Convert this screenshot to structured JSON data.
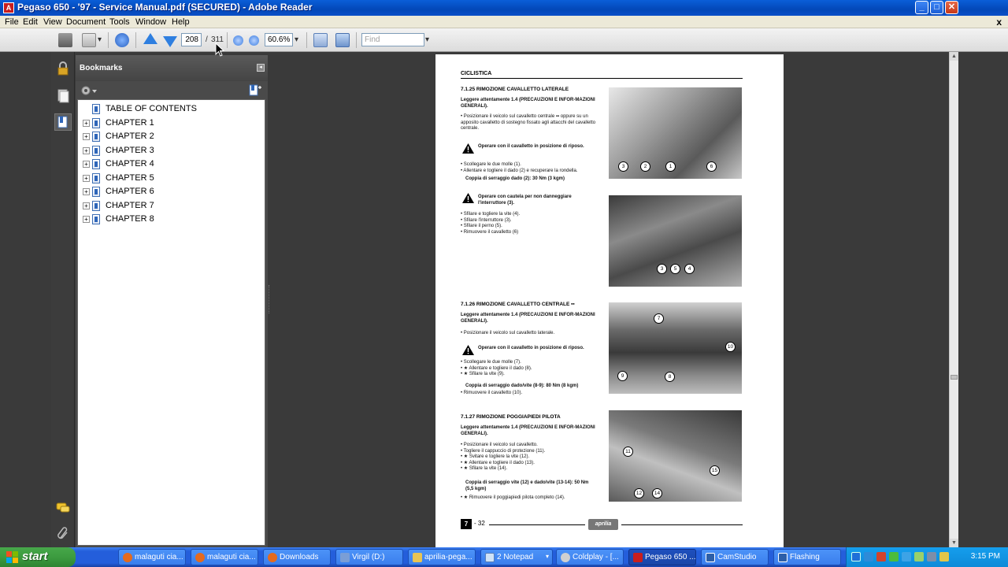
{
  "window": {
    "title": "Pegaso 650 - '97 - Service Manual.pdf (SECURED) - Adobe Reader",
    "app_icon_glyph": "A",
    "minimize": "_",
    "maximize": "□",
    "close": "✕"
  },
  "menu": {
    "items": [
      "File",
      "Edit",
      "View",
      "Document",
      "Tools",
      "Window",
      "Help"
    ],
    "doc_close": "x"
  },
  "toolbar": {
    "page_current": "208",
    "page_separator": "/",
    "page_total": "311",
    "zoom": "60.6%",
    "find_placeholder": "Find"
  },
  "bookmarks": {
    "title": "Bookmarks",
    "items": [
      {
        "label": "TABLE OF CONTENTS",
        "expandable": false
      },
      {
        "label": "CHAPTER 1",
        "expandable": true
      },
      {
        "label": "CHAPTER 2",
        "expandable": true
      },
      {
        "label": "CHAPTER 3",
        "expandable": true
      },
      {
        "label": "CHAPTER 4",
        "expandable": true
      },
      {
        "label": "CHAPTER 5",
        "expandable": true
      },
      {
        "label": "CHAPTER 6",
        "expandable": true
      },
      {
        "label": "CHAPTER 7",
        "expandable": true
      },
      {
        "label": "CHAPTER 8",
        "expandable": true
      }
    ]
  },
  "page": {
    "header": "CICLISTICA",
    "sections": [
      {
        "title": "7.1.25  RIMOZIONE CAVALLETTO LATERALE",
        "intro": "Leggere attentamente 1.4 (PRECAUZIONI E INFOR-MAZIONI GENERALI).",
        "bullet1": "• Posizionare il veicolo sul cavalletto centrale ▪▪ oppure su un apposito cavalletto di sostegno fissato agli attacchi del cavalletto centrale.",
        "warning1": "Operare con il cavalletto in posizione di riposo.",
        "steps1": "• Scollegare le due molle (1).\n• Allentare e togliere il dado (2) e recuperare la rondella.",
        "torque1": "Coppia di serraggio dado (2): 30 Nm (3 kgm)",
        "warning2": "Operare con cautela per non danneggiare l'interruttore (3).",
        "steps2": "• Sfilare e togliere la vite (4).\n• Sfilare l'interruttore (3).\n• Sfilare il perno (5).\n• Rimuovere il cavalletto (6)",
        "photo1_callouts": [
          "3",
          "2",
          "1",
          "6"
        ],
        "photo2_callouts": [
          "3",
          "5",
          "4"
        ]
      },
      {
        "title": "7.1.26  RIMOZIONE CAVALLETTO CENTRALE ▪▪",
        "intro": "Leggere attentamente 1.4 (PRECAUZIONI E INFOR-MAZIONI GENERALI).",
        "bullet1": "• Posizionare il veicolo sul cavalletto laterale.",
        "warning1": "Operare con il cavalletto in posizione di riposo.",
        "steps1": "• Scollegare le due molle (7).\n• ★ Allentare e togliere il dado (8).\n• ★ Sfilare la vite (9).",
        "torque1": "Coppia di serraggio dado/vite (8-9): 80 Nm (8 kgm)",
        "steps2": "• Rimuovere il cavalletto (10).",
        "photo_callouts": [
          "7",
          "10",
          "9",
          "8"
        ]
      },
      {
        "title": "7.1.27  RIMOZIONE POGGIAPIEDI PILOTA",
        "intro": "Leggere attentamente 1.4 (PRECAUZIONI E INFOR-MAZIONI GENERALI).",
        "steps1": "• Posizionare il veicolo sul cavalletto.\n• Togliere il cappuccio di protezione (11).\n• ★ Svitare e togliere la vite (12).\n• ★ Allentare e togliere il dado (13).\n• ★ Sfilare la vite (14).",
        "torque1": "Coppia di serraggio vite (12) e dado/vite (13-14): 50 Nm (5,5 kgm)",
        "steps2": "• ★ Rimuovere il poggiapiedi pilota completo (14).",
        "photo_callouts": [
          "11",
          "15",
          "12",
          "14"
        ]
      }
    ],
    "footer_chapter": "7",
    "footer_page": "- 32",
    "footer_logo": "aprilia"
  },
  "taskbar": {
    "start": "start",
    "tasks": [
      {
        "label": "malaguti cia...",
        "color": "#e56a1e"
      },
      {
        "label": "malaguti cia...",
        "color": "#e56a1e"
      },
      {
        "label": "Downloads",
        "color": "#e56a1e"
      },
      {
        "label": "Virgil (D:)",
        "color": "#7a9ed6"
      },
      {
        "label": "aprilia-pega...",
        "color": "#e8c453"
      },
      {
        "label": "2 Notepad",
        "color": "#cfe3f7"
      },
      {
        "label": "Coldplay - [...",
        "color": "#d0d0d0"
      },
      {
        "label": "Pegaso 650 ...",
        "color": "#c81e1e"
      },
      {
        "label": "CamStudio",
        "color": "#2d5fa8"
      },
      {
        "label": "Flashing",
        "color": "#2d5fa8"
      }
    ],
    "clock": "3:15 PM"
  }
}
